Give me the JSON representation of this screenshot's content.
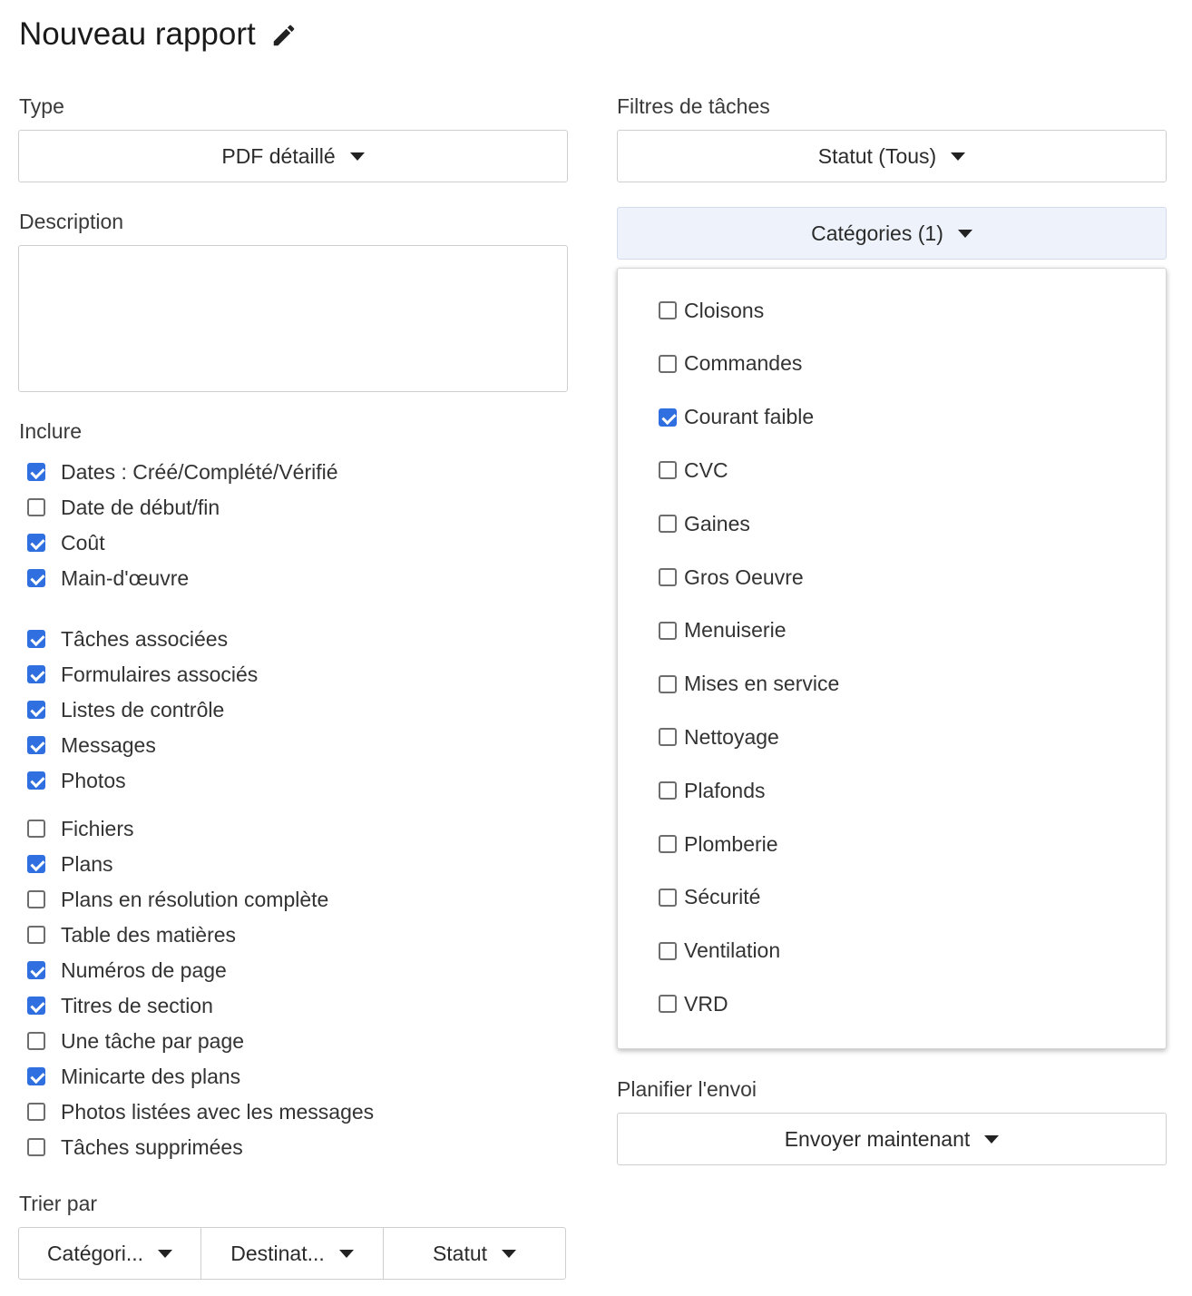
{
  "header": {
    "title": "Nouveau rapport",
    "edit_icon": "pencil-icon"
  },
  "type": {
    "label": "Type",
    "value": "PDF détaillé"
  },
  "description": {
    "label": "Description",
    "value": ""
  },
  "include": {
    "label": "Inclure",
    "group1": [
      {
        "label": "Dates : Créé/Complété/Vérifié",
        "checked": true
      },
      {
        "label": "Date de début/fin",
        "checked": false
      },
      {
        "label": "Coût",
        "checked": true
      },
      {
        "label": "Main-d'œuvre",
        "checked": true
      }
    ],
    "group2": [
      {
        "label": "Tâches associées",
        "checked": true
      },
      {
        "label": "Formulaires associés",
        "checked": true
      },
      {
        "label": "Listes de contrôle",
        "checked": true
      },
      {
        "label": "Messages",
        "checked": true
      },
      {
        "label": "Photos",
        "checked": true
      }
    ],
    "group3": [
      {
        "label": "Fichiers",
        "checked": false
      },
      {
        "label": "Plans",
        "checked": true
      },
      {
        "label": "Plans en résolution complète",
        "checked": false
      },
      {
        "label": "Table des matières",
        "checked": false
      },
      {
        "label": "Numéros de page",
        "checked": true
      },
      {
        "label": "Titres de section",
        "checked": true
      },
      {
        "label": "Une tâche par page",
        "checked": false
      },
      {
        "label": "Minicarte des plans",
        "checked": true
      },
      {
        "label": "Photos listées avec les messages",
        "checked": false
      },
      {
        "label": "Tâches supprimées",
        "checked": false
      }
    ]
  },
  "sort": {
    "label": "Trier par",
    "options": [
      "Catégori...",
      "Destinat...",
      "Statut"
    ]
  },
  "filters": {
    "label": "Filtres de tâches",
    "status": "Statut (Tous)",
    "categories": "Catégories (1)"
  },
  "categories_dropdown": [
    {
      "label": "Cloisons",
      "checked": false
    },
    {
      "label": "Commandes",
      "checked": false
    },
    {
      "label": "Courant faible",
      "checked": true
    },
    {
      "label": "CVC",
      "checked": false
    },
    {
      "label": "Gaines",
      "checked": false
    },
    {
      "label": "Gros Oeuvre",
      "checked": false
    },
    {
      "label": "Menuiserie",
      "checked": false
    },
    {
      "label": "Mises en service",
      "checked": false
    },
    {
      "label": "Nettoyage",
      "checked": false
    },
    {
      "label": "Plafonds",
      "checked": false
    },
    {
      "label": "Plomberie",
      "checked": false
    },
    {
      "label": "Sécurité",
      "checked": false
    },
    {
      "label": "Ventilation",
      "checked": false
    },
    {
      "label": "VRD",
      "checked": false
    }
  ],
  "schedule": {
    "label": "Planifier l'envoi",
    "value": "Envoyer maintenant"
  },
  "colors": {
    "accent": "#2f6fe0",
    "active_bg": "#edf2fb"
  }
}
